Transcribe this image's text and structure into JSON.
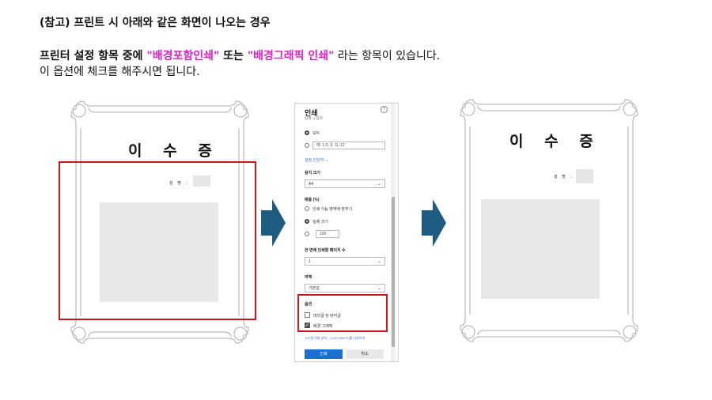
{
  "heading": "(참고) 프린트 시 아래와 같은 화면이 나오는 경우",
  "instruction": {
    "prefix": "프린터 설정 항목 중에 ",
    "option1": "\"배경포함인쇄\"",
    "mid": " 또는 ",
    "option2": "\"배경그래픽 인쇄\"",
    "suffix": " 라는 항목이 있습니다.",
    "line2": "이 옵션에 체크를 해주시면 됩니다."
  },
  "certificate": {
    "title": "이 수 증",
    "name_label": "성 명 :"
  },
  "print_dialog": {
    "title": "인쇄",
    "sheet_count": "합계: 1 용지",
    "pages_all": "모두",
    "pages_placeholder": "예: 1-5, 8, 11-13",
    "simple_settings_link": "설정 간단히 ⌄",
    "paper_size_label": "용지 크기",
    "paper_size_value": "A4",
    "scale_label": "배율 (%)",
    "fit_to_printable": "인쇄 가능 영역에 맞추기",
    "actual_size": "실제 크기",
    "scale_value": "100",
    "pages_per_sheet_label": "한 면에 인쇄할 페이지 수",
    "pages_per_sheet_value": "1",
    "margins_label": "여백",
    "margins_value": "기본값",
    "options_label": "옵션",
    "headers_footers": "머리글 및 바닥글",
    "background_graphics": "배경 그래픽",
    "system_dialog_link": "시스템 대화 상자... (Ctrl+Shift+P)를 사용하여",
    "print_button": "인쇄",
    "cancel_button": "취소"
  },
  "colors": {
    "highlight": "#e020c8",
    "red_box": "#c8171e",
    "arrow": "#1f5c82",
    "print_button": "#1a6fd1"
  },
  "icons": [
    "arrow-right-icon",
    "arrow-right-icon",
    "help-icon",
    "chevron-down-icon",
    "checkmark-icon"
  ]
}
